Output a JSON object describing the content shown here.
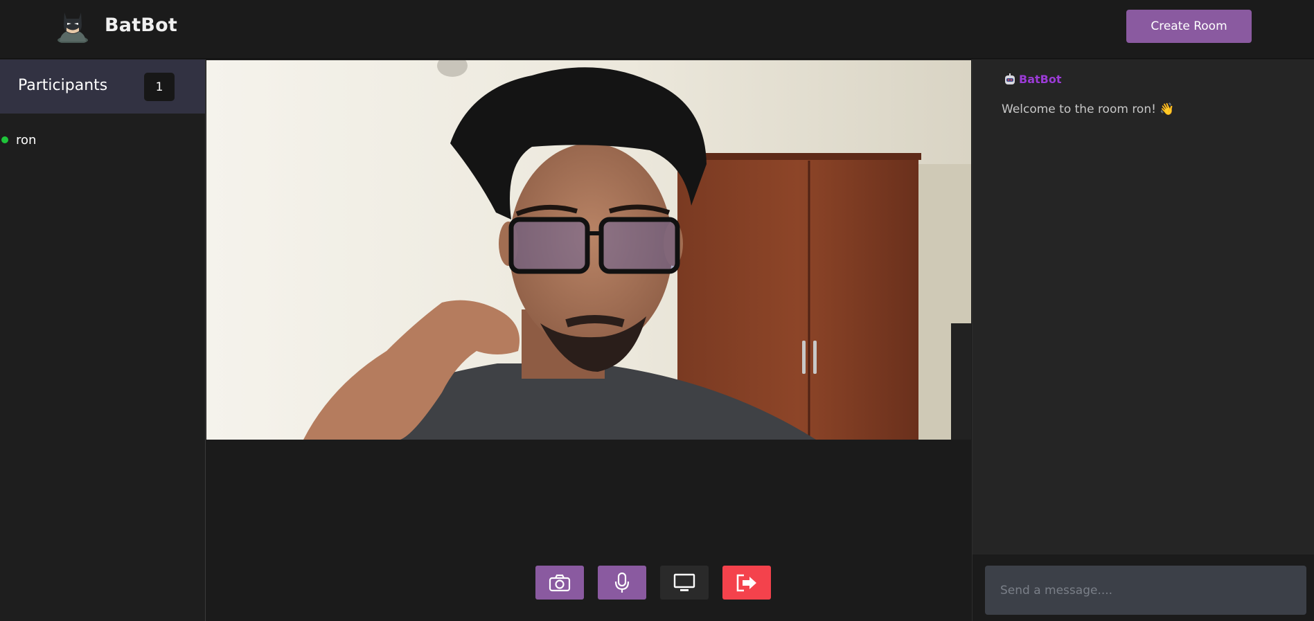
{
  "app": {
    "brand": "BatBot",
    "create_room_label": "Create Room"
  },
  "participants": {
    "title": "Participants",
    "count": "1",
    "list": [
      {
        "name": "ron",
        "status": "online",
        "status_color": "#1fc43a"
      }
    ]
  },
  "controls": [
    {
      "icon": "camera-icon",
      "color": "#8a5aa0"
    },
    {
      "icon": "microphone-icon",
      "color": "#8a5aa0"
    },
    {
      "icon": "screen-share-icon",
      "color": "#2a2a2a"
    },
    {
      "icon": "leave-room-icon",
      "color": "#f4424c"
    }
  ],
  "chat": {
    "messages": [
      {
        "author": "BatBot",
        "author_color": "#9b3bd6",
        "text": "Welcome to the room ron! 👋"
      }
    ],
    "input_placeholder": "Send a message...."
  },
  "colors": {
    "accent": "#8a5aa0",
    "danger": "#f4424c",
    "participants_header": "#323242"
  }
}
